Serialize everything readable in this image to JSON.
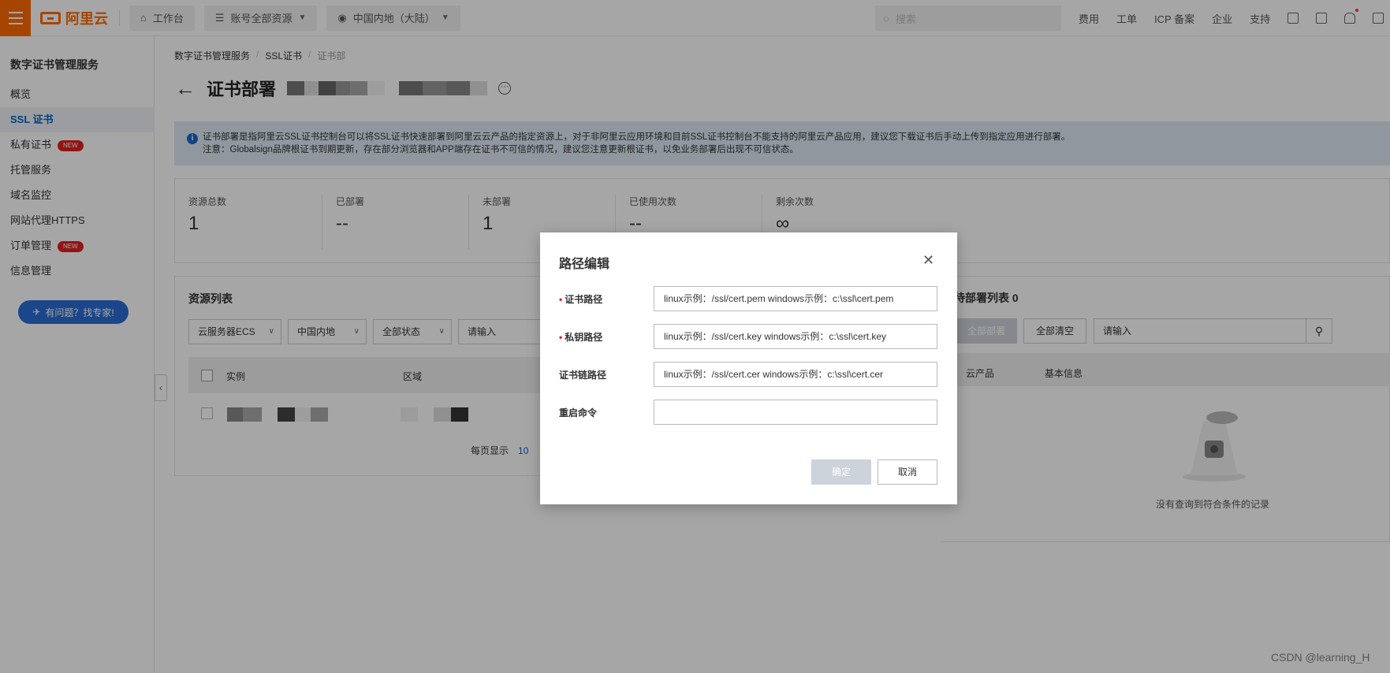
{
  "topbar": {
    "brand": "阿里云",
    "workbench": "工作台",
    "account_scope": "账号全部资源",
    "region": "中国内地（大陆）",
    "search_placeholder": "搜索",
    "links": [
      "费用",
      "工单",
      "ICP 备案",
      "企业",
      "支持"
    ]
  },
  "sidebar": {
    "title": "数字证书管理服务",
    "items": [
      {
        "label": "概览"
      },
      {
        "label": "SSL 证书"
      },
      {
        "label": "私有证书",
        "badge": "NEW"
      },
      {
        "label": "托管服务"
      },
      {
        "label": "域名监控"
      },
      {
        "label": "网站代理HTTPS"
      },
      {
        "label": "订单管理",
        "badge": "NEW"
      },
      {
        "label": "信息管理"
      }
    ],
    "help_button": "有问题？找专家!"
  },
  "breadcrumb": [
    "数字证书管理服务",
    "SSL证书",
    "证书部"
  ],
  "page": {
    "title": "证书部署"
  },
  "notice": {
    "line1": "证书部署是指阿里云SSL证书控制台可以将SSL证书快速部署到阿里云云产品的指定资源上，对于非阿里云应用环境和目前SSL证书控制台不能支持的阿里云产品应用，建议您下载证书后手动上传到指定应用进行部署。",
    "line2": "注意：Globalsign品牌根证书到期更新，存在部分浏览器和APP端存在证书不可信的情况，建议您注意更新根证书，以免业务部署后出现不可信状态。"
  },
  "stats": [
    {
      "label": "资源总数",
      "value": "1"
    },
    {
      "label": "已部署",
      "value": "--"
    },
    {
      "label": "未部署",
      "value": "1"
    },
    {
      "label": "已使用次数",
      "value": "--"
    },
    {
      "label": "剩余次数",
      "value": "∞"
    }
  ],
  "resources": {
    "title": "资源列表",
    "filters": [
      "云服务器ECS",
      "中国内地",
      "全部状态"
    ],
    "search_placeholder": "请输入",
    "columns": [
      "实例",
      "区域"
    ],
    "per_page_label": "每页显示",
    "per_page_value": "10"
  },
  "deploy_list": {
    "title": "待部署列表 0",
    "deploy_all": "全部部署",
    "clear_all": "全部清空",
    "search_placeholder": "请输入",
    "columns": [
      "云产品",
      "基本信息"
    ],
    "empty_text": "没有查询到符合条件的记录"
  },
  "dialog": {
    "title": "路径编辑",
    "fields": [
      {
        "label": "证书路径",
        "required": true,
        "value": "linux示例：/ssl/cert.pem  windows示例：c:\\ssl\\cert.pem"
      },
      {
        "label": "私钥路径",
        "required": true,
        "value": "linux示例：/ssl/cert.key  windows示例：c:\\ssl\\cert.key"
      },
      {
        "label": "证书链路径",
        "required": false,
        "value": "linux示例：/ssl/cert.cer   windows示例：c:\\ssl\\cert.cer"
      },
      {
        "label": "重启命令",
        "required": false,
        "value": ""
      }
    ],
    "ok": "确定",
    "cancel": "取消"
  },
  "watermark": "CSDN @learning_H",
  "colors": {
    "brand": "#ff6a00",
    "active": "#0064c8",
    "badge": "#e02020",
    "notice_bg": "#dde8f5"
  }
}
